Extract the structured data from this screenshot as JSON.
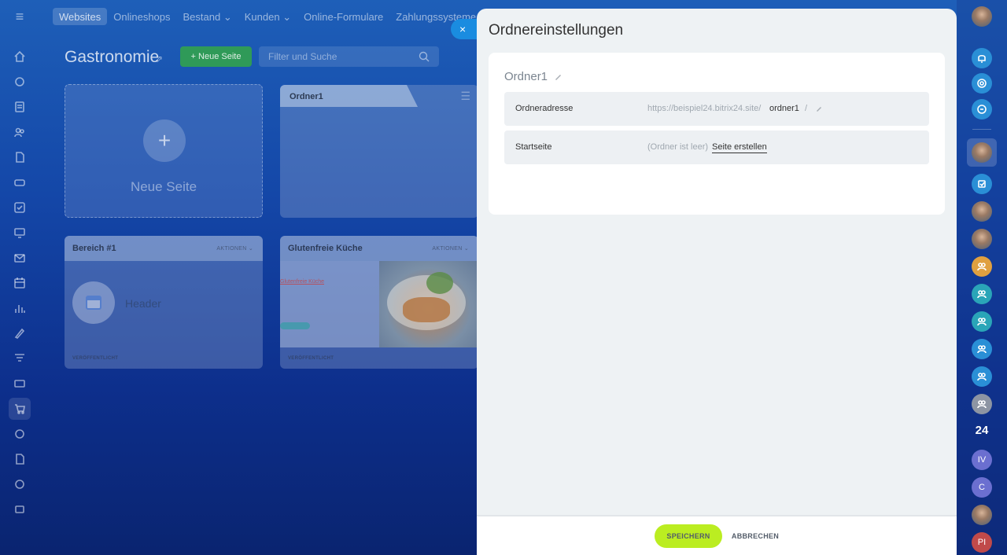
{
  "topmenu": {
    "items": [
      "Websites",
      "Onlineshops",
      "Bestand",
      "Kunden",
      "Online-Formulare",
      "Zahlungssysteme und Li"
    ],
    "dropdown_marks": [
      "",
      "",
      "⌄",
      "⌄",
      "",
      ""
    ]
  },
  "page": {
    "title": "Gastronomie",
    "new_page_button": "+ Neue Seite",
    "search_placeholder": "Filter und Suche"
  },
  "cards": {
    "new_page_label": "Neue Seite",
    "folder_title": "Ordner1",
    "site1": {
      "title": "Bereich #1",
      "actions": "AKTIONEN",
      "status": "VERÖFFENTLICHT",
      "header_label": "Header"
    },
    "site2": {
      "title": "Glutenfreie Küche",
      "actions": "AKTIONEN",
      "status": "VERÖFFENTLICHT",
      "preview_title": "Glutenfreie Küche"
    }
  },
  "panel": {
    "title": "Ordnereinstellungen",
    "folder_name": "Ordner1",
    "address_label": "Ordneradresse",
    "address_base": "https://beispiel24.bitrix24.site/",
    "address_slug": "ordner1",
    "address_slash": "/",
    "start_label": "Startseite",
    "start_note": "(Ordner ist leer)",
    "start_link": "Seite erstellen",
    "save": "SPEICHERN",
    "cancel": "ABBRECHEN",
    "close_icon": "×"
  },
  "right_bar": {
    "counter": "24",
    "user_initials": [
      "IV",
      "C",
      "PI"
    ]
  },
  "colors": {
    "save_button": "#bbed21",
    "close_tab": "#1a8ce0",
    "new_page_button": "#2f9a58"
  }
}
